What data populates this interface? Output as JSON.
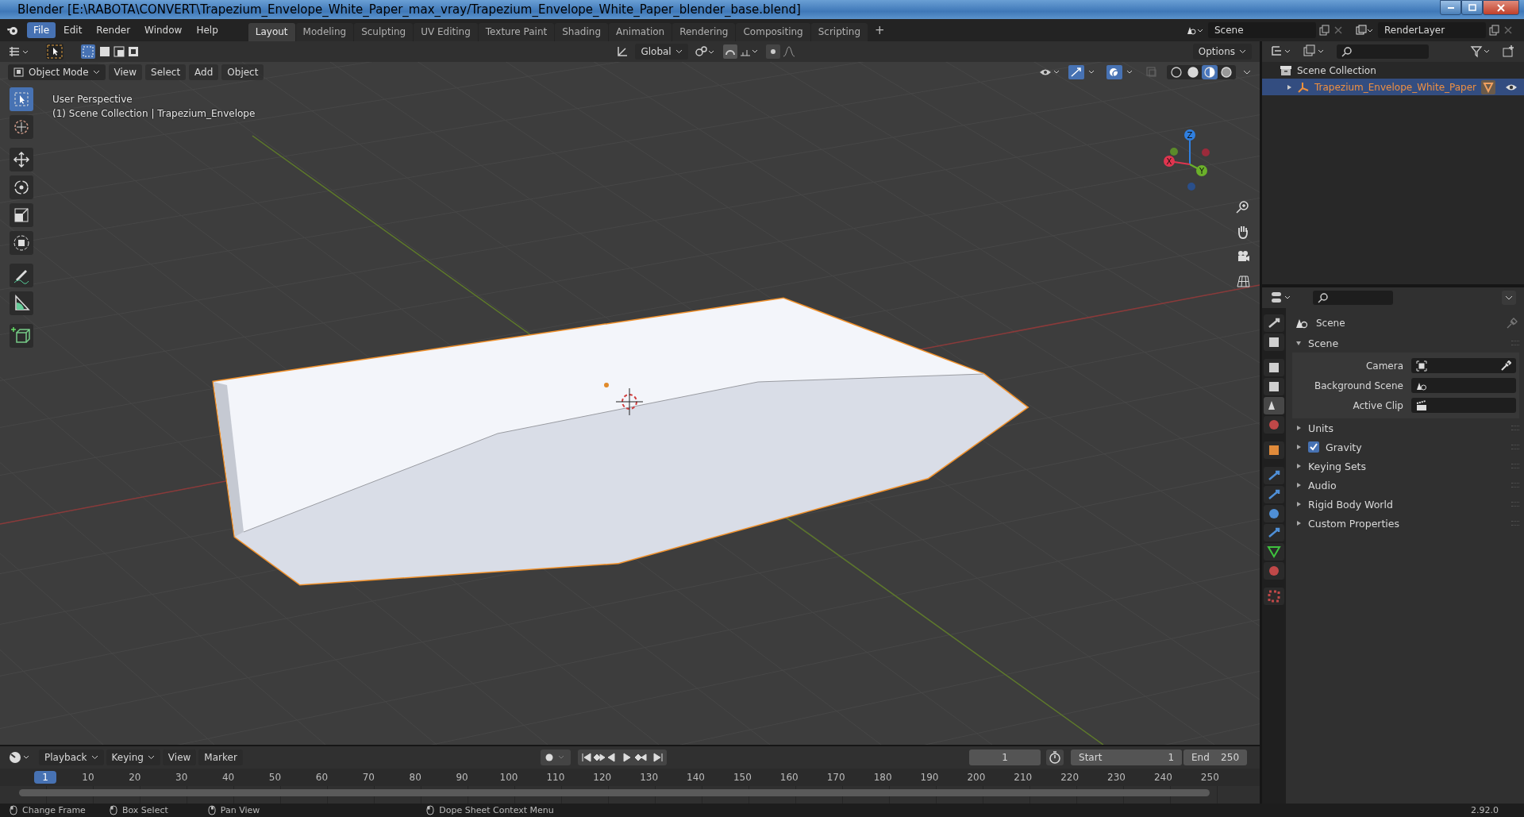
{
  "window": {
    "title": "Blender [E:\\RABOTA\\CONVERT\\Trapezium_Envelope_White_Paper_max_vray/Trapezium_Envelope_White_Paper_blender_base.blend]",
    "controls": [
      {
        "kind": "minimize"
      },
      {
        "kind": "maximize"
      },
      {
        "kind": "close"
      }
    ]
  },
  "menu": [
    {
      "label": "File",
      "selected": true
    },
    {
      "label": "Edit",
      "selected": false
    },
    {
      "label": "Render",
      "selected": false
    },
    {
      "label": "Window",
      "selected": false
    },
    {
      "label": "Help",
      "selected": false
    }
  ],
  "workspaces": [
    {
      "label": "Layout",
      "selected": true
    },
    {
      "label": "Modeling",
      "selected": false
    },
    {
      "label": "Sculpting",
      "selected": false
    },
    {
      "label": "UV Editing",
      "selected": false
    },
    {
      "label": "Texture Paint",
      "selected": false
    },
    {
      "label": "Shading",
      "selected": false
    },
    {
      "label": "Animation",
      "selected": false
    },
    {
      "label": "Rendering",
      "selected": false
    },
    {
      "label": "Compositing",
      "selected": false
    },
    {
      "label": "Scripting",
      "selected": false
    }
  ],
  "add_workspace": "+",
  "scene": {
    "value": "Scene"
  },
  "view_layer": {
    "value": "RenderLayer"
  },
  "viewport": {
    "orientation": "Global",
    "options": "Options",
    "mode": "Object Mode",
    "menus": [
      "View",
      "Select",
      "Add",
      "Object"
    ],
    "info": [
      "User Perspective",
      "(1) Scene Collection | Trapezium_Envelope"
    ],
    "tools": [
      {
        "kind": "select",
        "selected": true
      },
      {
        "kind": "cursor",
        "selected": false
      },
      {
        "kind": "move",
        "selected": false
      },
      {
        "kind": "rotate",
        "selected": false
      },
      {
        "kind": "scale",
        "selected": false
      },
      {
        "kind": "transform",
        "selected": false
      },
      {
        "kind": "annotate",
        "selected": false
      },
      {
        "kind": "measure",
        "selected": false
      },
      {
        "kind": "add-cube",
        "selected": false
      }
    ],
    "shading": [
      {
        "kind": "wireframe",
        "selected": false
      },
      {
        "kind": "solid",
        "selected": false
      },
      {
        "kind": "material",
        "selected": true
      },
      {
        "kind": "rendered",
        "selected": false
      }
    ],
    "gizmo": {
      "x": "X",
      "y": "Y",
      "z": "Z"
    }
  },
  "outliner": {
    "root": "Scene Collection",
    "items": [
      {
        "label": "Trapezium_Envelope_White_Paper",
        "selected": true
      }
    ]
  },
  "properties": {
    "context": "Scene",
    "tabs": [
      {
        "kind": "tool",
        "selected": false
      },
      {
        "kind": "render",
        "selected": false
      },
      {
        "kind": "output",
        "selected": false
      },
      {
        "kind": "view-layer",
        "selected": false
      },
      {
        "kind": "scene",
        "selected": true
      },
      {
        "kind": "world",
        "selected": false
      },
      {
        "kind": "object",
        "selected": false
      },
      {
        "kind": "modifier",
        "selected": false
      },
      {
        "kind": "particles",
        "selected": false
      },
      {
        "kind": "physics",
        "selected": false
      },
      {
        "kind": "constraint",
        "selected": false
      },
      {
        "kind": "data",
        "selected": false
      },
      {
        "kind": "material",
        "selected": false
      },
      {
        "kind": "texture",
        "selected": false
      }
    ],
    "panels": [
      {
        "label": "Scene",
        "expanded": true,
        "fields": [
          {
            "label": "Camera",
            "kind": "camera"
          },
          {
            "label": "Background Scene",
            "kind": "scene"
          },
          {
            "label": "Active Clip",
            "kind": "clip"
          }
        ]
      },
      {
        "label": "Units",
        "expanded": false
      },
      {
        "label": "Gravity",
        "expanded": false,
        "kind": "checkbox",
        "checked": true
      },
      {
        "label": "Keying Sets",
        "expanded": false
      },
      {
        "label": "Audio",
        "expanded": false
      },
      {
        "label": "Rigid Body World",
        "expanded": false
      },
      {
        "label": "Custom Properties",
        "expanded": false
      }
    ]
  },
  "timeline": {
    "menus": [
      "Playback",
      "Keying",
      "View",
      "Marker"
    ],
    "current_frame": "1",
    "start_label": "Start",
    "start": "1",
    "end_label": "End",
    "end": "250",
    "ruler": [
      {
        "label": "1",
        "selected": true
      },
      {
        "label": "10",
        "selected": false
      },
      {
        "label": "20",
        "selected": false
      },
      {
        "label": "30",
        "selected": false
      },
      {
        "label": "40",
        "selected": false
      },
      {
        "label": "50",
        "selected": false
      },
      {
        "label": "60",
        "selected": false
      },
      {
        "label": "70",
        "selected": false
      },
      {
        "label": "80",
        "selected": false
      },
      {
        "label": "90",
        "selected": false
      },
      {
        "label": "100",
        "selected": false
      },
      {
        "label": "110",
        "selected": false
      },
      {
        "label": "120",
        "selected": false
      },
      {
        "label": "130",
        "selected": false
      },
      {
        "label": "140",
        "selected": false
      },
      {
        "label": "150",
        "selected": false
      },
      {
        "label": "160",
        "selected": false
      },
      {
        "label": "170",
        "selected": false
      },
      {
        "label": "180",
        "selected": false
      },
      {
        "label": "190",
        "selected": false
      },
      {
        "label": "200",
        "selected": false
      },
      {
        "label": "210",
        "selected": false
      },
      {
        "label": "220",
        "selected": false
      },
      {
        "label": "230",
        "selected": false
      },
      {
        "label": "240",
        "selected": false
      },
      {
        "label": "250",
        "selected": false
      }
    ]
  },
  "status_bar": {
    "hints": [
      "Change Frame",
      "Box Select",
      "Pan View",
      "Dope Sheet Context Menu"
    ],
    "version": "2.92.0"
  }
}
